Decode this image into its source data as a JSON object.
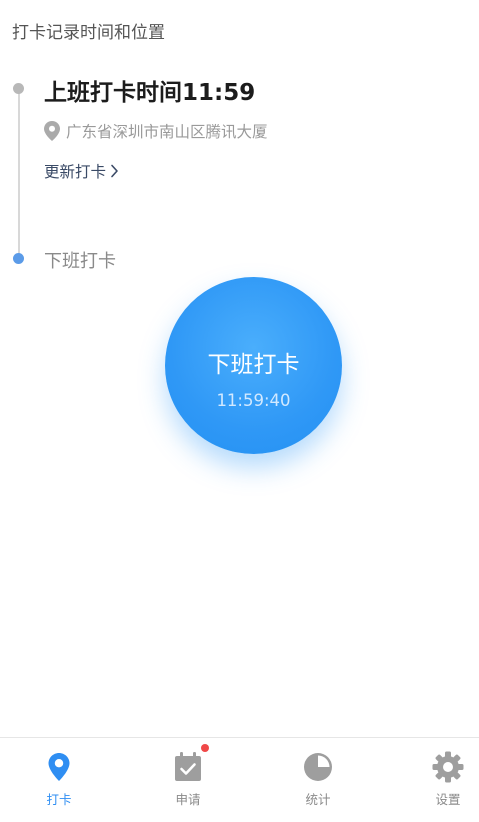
{
  "header": {
    "title": "打卡记录时间和位置"
  },
  "timeline": {
    "checkin": {
      "title": "上班打卡时间11:59",
      "location": "广东省深圳市南山区腾讯大厦",
      "update_link": "更新打卡"
    },
    "checkout": {
      "label": "下班打卡"
    }
  },
  "punch_button": {
    "label": "下班打卡",
    "time": "11:59:40"
  },
  "tabbar": {
    "tabs": [
      {
        "label": "打卡",
        "icon": "location-pin-icon",
        "active": true
      },
      {
        "label": "申请",
        "icon": "calendar-check-icon",
        "badge": true
      },
      {
        "label": "统计",
        "icon": "pie-chart-icon"
      },
      {
        "label": "设置",
        "icon": "gear-icon"
      }
    ]
  },
  "colors": {
    "accent": "#2f98f6",
    "timeline_active_dot": "#5b9be8",
    "badge": "#f04848"
  }
}
